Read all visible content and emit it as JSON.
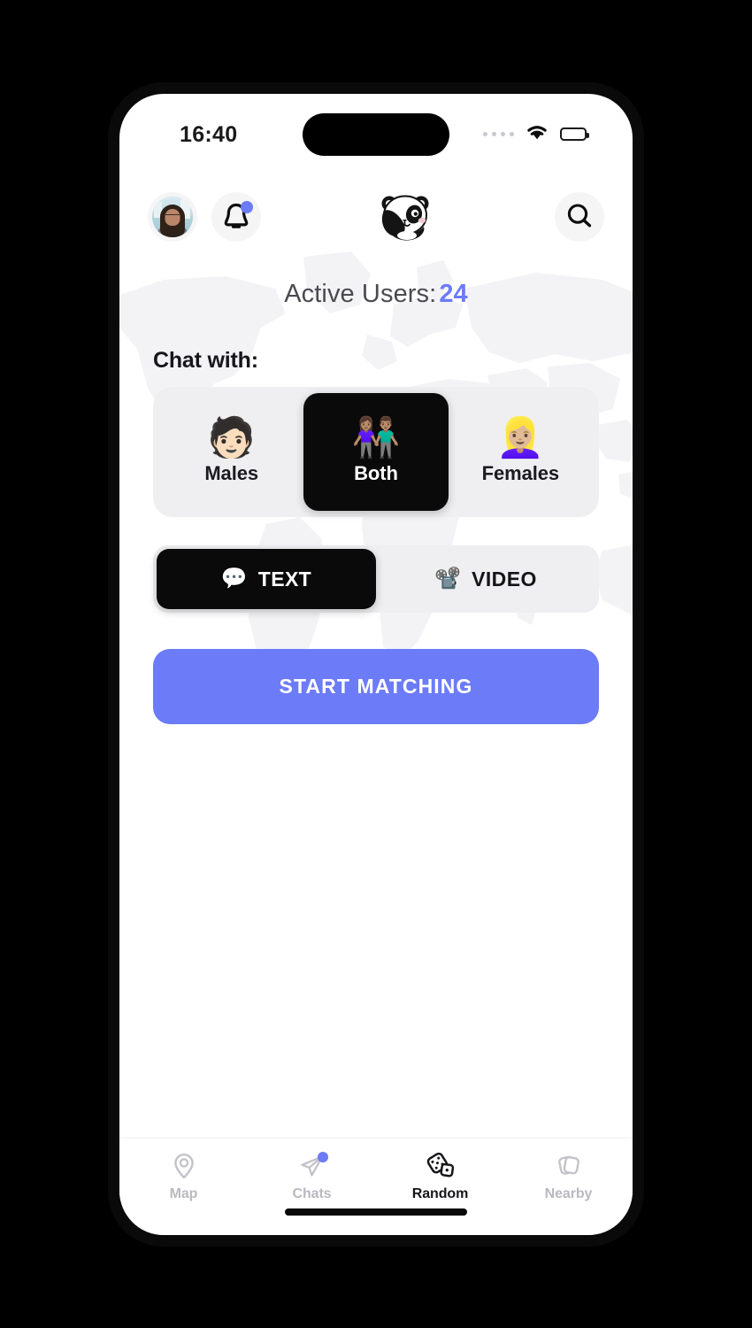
{
  "status_bar": {
    "time": "16:40",
    "cellular_icon": "cellular-dots-icon",
    "wifi_icon": "wifi-icon",
    "battery_icon": "battery-full-icon"
  },
  "header": {
    "avatar": "user-avatar",
    "notifications_icon": "bell-icon",
    "notification_badge": true,
    "logo": "panda-logo",
    "search_icon": "search-icon"
  },
  "main": {
    "active_users_label": "Active Users:",
    "active_users_count": "24",
    "chat_with_label": "Chat with:",
    "gender_options": [
      {
        "id": "males",
        "emoji": "🧑🏻",
        "label": "Males",
        "selected": false
      },
      {
        "id": "both",
        "emoji": "👫🏽",
        "label": "Both",
        "selected": true
      },
      {
        "id": "females",
        "emoji": "👱🏼‍♀️",
        "label": "Females",
        "selected": false
      }
    ],
    "mode_options": [
      {
        "id": "text",
        "emoji": "💬",
        "label": "TEXT",
        "selected": true
      },
      {
        "id": "video",
        "emoji": "📽️",
        "label": "VIDEO",
        "selected": false
      }
    ],
    "start_button_label": "START MATCHING"
  },
  "tab_bar": {
    "items": [
      {
        "id": "map",
        "icon": "map-pin-icon",
        "label": "Map",
        "active": false,
        "badge": false
      },
      {
        "id": "chats",
        "icon": "paper-plane-icon",
        "label": "Chats",
        "active": false,
        "badge": true
      },
      {
        "id": "random",
        "icon": "dice-icon",
        "label": "Random",
        "active": true,
        "badge": false
      },
      {
        "id": "nearby",
        "icon": "card-stack-icon",
        "label": "Nearby",
        "active": false,
        "badge": false
      }
    ]
  },
  "colors": {
    "accent": "#6c7bf7",
    "active_dark": "#0a0a0a",
    "track": "#efeff1",
    "inactive_text": "#b9b9c0",
    "map_watermark": "#f3f3f5"
  }
}
